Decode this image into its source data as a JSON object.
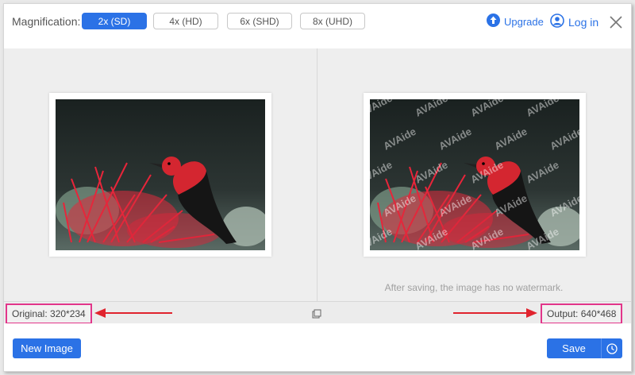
{
  "topbar": {
    "magnification_label": "Magnification:",
    "options": [
      "2x (SD)",
      "4x (HD)",
      "6x (SHD)",
      "8x (UHD)"
    ],
    "selected_option": "2x (SD)",
    "upgrade_label": "Upgrade",
    "login_label": "Log in"
  },
  "preview": {
    "watermark_text": "AVAide",
    "note": "After saving, the image has no watermark."
  },
  "info": {
    "original": "Original: 320*234",
    "output": "Output: 640*468"
  },
  "bottom": {
    "new_image_label": "New Image",
    "save_label": "Save"
  },
  "colors": {
    "accent": "#2b72e6",
    "highlight_box": "#e2358a",
    "arrow": "#e0242e"
  }
}
